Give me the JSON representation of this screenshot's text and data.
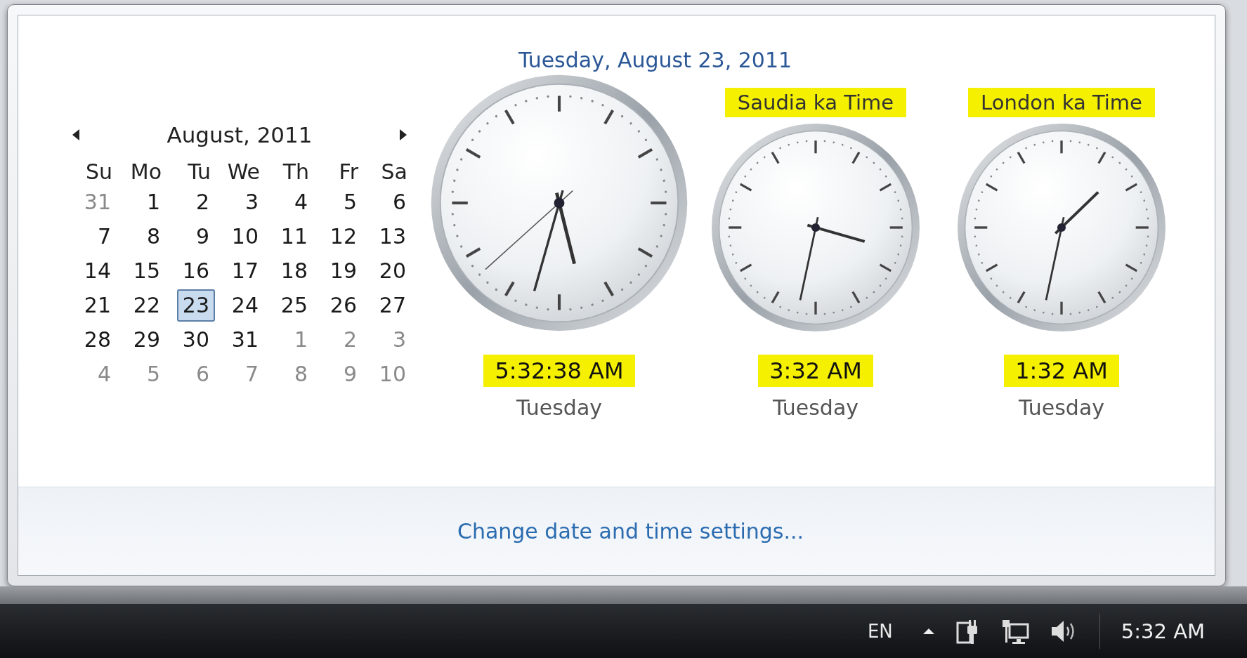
{
  "flyout": {
    "date_title": "Tuesday, August 23, 2011",
    "calendar": {
      "month": "August, 2011",
      "weekdays": [
        "Su",
        "Mo",
        "Tu",
        "We",
        "Th",
        "Fr",
        "Sa"
      ],
      "weeks": [
        [
          {
            "day": "31",
            "current_month": false,
            "selected": false
          },
          {
            "day": "1",
            "current_month": true,
            "selected": false
          },
          {
            "day": "2",
            "current_month": true,
            "selected": false
          },
          {
            "day": "3",
            "current_month": true,
            "selected": false
          },
          {
            "day": "4",
            "current_month": true,
            "selected": false
          },
          {
            "day": "5",
            "current_month": true,
            "selected": false
          },
          {
            "day": "6",
            "current_month": true,
            "selected": false
          }
        ],
        [
          {
            "day": "7",
            "current_month": true,
            "selected": false
          },
          {
            "day": "8",
            "current_month": true,
            "selected": false
          },
          {
            "day": "9",
            "current_month": true,
            "selected": false
          },
          {
            "day": "10",
            "current_month": true,
            "selected": false
          },
          {
            "day": "11",
            "current_month": true,
            "selected": false
          },
          {
            "day": "12",
            "current_month": true,
            "selected": false
          },
          {
            "day": "13",
            "current_month": true,
            "selected": false
          }
        ],
        [
          {
            "day": "14",
            "current_month": true,
            "selected": false
          },
          {
            "day": "15",
            "current_month": true,
            "selected": false
          },
          {
            "day": "16",
            "current_month": true,
            "selected": false
          },
          {
            "day": "17",
            "current_month": true,
            "selected": false
          },
          {
            "day": "18",
            "current_month": true,
            "selected": false
          },
          {
            "day": "19",
            "current_month": true,
            "selected": false
          },
          {
            "day": "20",
            "current_month": true,
            "selected": false
          }
        ],
        [
          {
            "day": "21",
            "current_month": true,
            "selected": false
          },
          {
            "day": "22",
            "current_month": true,
            "selected": false
          },
          {
            "day": "23",
            "current_month": true,
            "selected": true
          },
          {
            "day": "24",
            "current_month": true,
            "selected": false
          },
          {
            "day": "25",
            "current_month": true,
            "selected": false
          },
          {
            "day": "26",
            "current_month": true,
            "selected": false
          },
          {
            "day": "27",
            "current_month": true,
            "selected": false
          }
        ],
        [
          {
            "day": "28",
            "current_month": true,
            "selected": false
          },
          {
            "day": "29",
            "current_month": true,
            "selected": false
          },
          {
            "day": "30",
            "current_month": true,
            "selected": false
          },
          {
            "day": "31",
            "current_month": true,
            "selected": false
          },
          {
            "day": "1",
            "current_month": false,
            "selected": false
          },
          {
            "day": "2",
            "current_month": false,
            "selected": false
          },
          {
            "day": "3",
            "current_month": false,
            "selected": false
          }
        ],
        [
          {
            "day": "4",
            "current_month": false,
            "selected": false
          },
          {
            "day": "5",
            "current_month": false,
            "selected": false
          },
          {
            "day": "6",
            "current_month": false,
            "selected": false
          },
          {
            "day": "7",
            "current_month": false,
            "selected": false
          },
          {
            "day": "8",
            "current_month": false,
            "selected": false
          },
          {
            "day": "9",
            "current_month": false,
            "selected": false
          },
          {
            "day": "10",
            "current_month": false,
            "selected": false
          }
        ]
      ]
    },
    "clocks": [
      {
        "kind": "main",
        "time": "5:32:38 AM",
        "day": "Tuesday",
        "highlighted": true
      },
      {
        "kind": "additional",
        "label": "Saudia ka Time",
        "time": "3:32 AM",
        "day": "Tuesday",
        "highlighted": true
      },
      {
        "kind": "additional",
        "label": "London ka Time",
        "time": "1:32 AM",
        "day": "Tuesday",
        "highlighted": true
      }
    ],
    "footer_link": "Change date and time settings..."
  },
  "taskbar": {
    "language": "EN",
    "clock": "5:32 AM"
  }
}
